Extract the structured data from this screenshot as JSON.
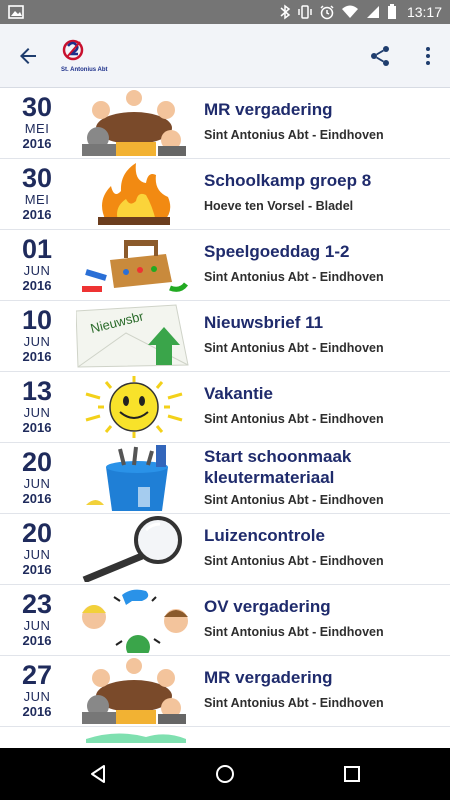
{
  "status_bar": {
    "time": "13:17",
    "icons": [
      "image-icon",
      "bluetooth-icon",
      "vibrate-icon",
      "alarm-icon",
      "wifi-icon",
      "signal-icon",
      "battery-icon"
    ]
  },
  "app_bar": {
    "logo_text": "St. Antonius Abt",
    "icons": [
      "back-arrow-icon",
      "share-icon",
      "more-vert-icon"
    ]
  },
  "colors": {
    "accent": "#1f2b6c",
    "date": "#1f2b5c",
    "status_bar": "#757575",
    "app_bar": "#f2f4f8"
  },
  "events": [
    {
      "day": "30",
      "month": "MEI",
      "year": "2016",
      "title": "MR vergadering",
      "location": "Sint Antonius Abt - Eindhoven",
      "thumb": "meeting"
    },
    {
      "day": "30",
      "month": "MEI",
      "year": "2016",
      "title": "Schoolkamp groep 8",
      "location": "Hoeve ten Vorsel - Bladel",
      "thumb": "fire"
    },
    {
      "day": "01",
      "month": "JUN",
      "year": "2016",
      "title": "Speelgoeddag 1-2",
      "location": "Sint Antonius Abt - Eindhoven",
      "thumb": "toolbox"
    },
    {
      "day": "10",
      "month": "JUN",
      "year": "2016",
      "title": "Nieuwsbrief 11",
      "location": "Sint Antonius Abt - Eindhoven",
      "thumb": "newsletter",
      "thumb_text": "Nieuwsbr"
    },
    {
      "day": "13",
      "month": "JUN",
      "year": "2016",
      "title": "Vakantie",
      "location": "Sint Antonius Abt - Eindhoven",
      "thumb": "sun"
    },
    {
      "day": "20",
      "month": "JUN",
      "year": "2016",
      "title": "Start schoonmaak kleutermateriaal",
      "location": "Sint Antonius Abt - Eindhoven",
      "thumb": "bucket"
    },
    {
      "day": "20",
      "month": "JUN",
      "year": "2016",
      "title": "Luizencontrole",
      "location": "Sint Antonius Abt - Eindhoven",
      "thumb": "magnifier"
    },
    {
      "day": "23",
      "month": "JUN",
      "year": "2016",
      "title": "OV vergadering",
      "location": "Sint Antonius Abt - Eindhoven",
      "thumb": "chat"
    },
    {
      "day": "27",
      "month": "JUN",
      "year": "2016",
      "title": "MR vergadering",
      "location": "Sint Antonius Abt - Eindhoven",
      "thumb": "meeting"
    }
  ],
  "nav_bar": {
    "icons": [
      "nav-back-icon",
      "nav-home-icon",
      "nav-recent-icon"
    ]
  }
}
